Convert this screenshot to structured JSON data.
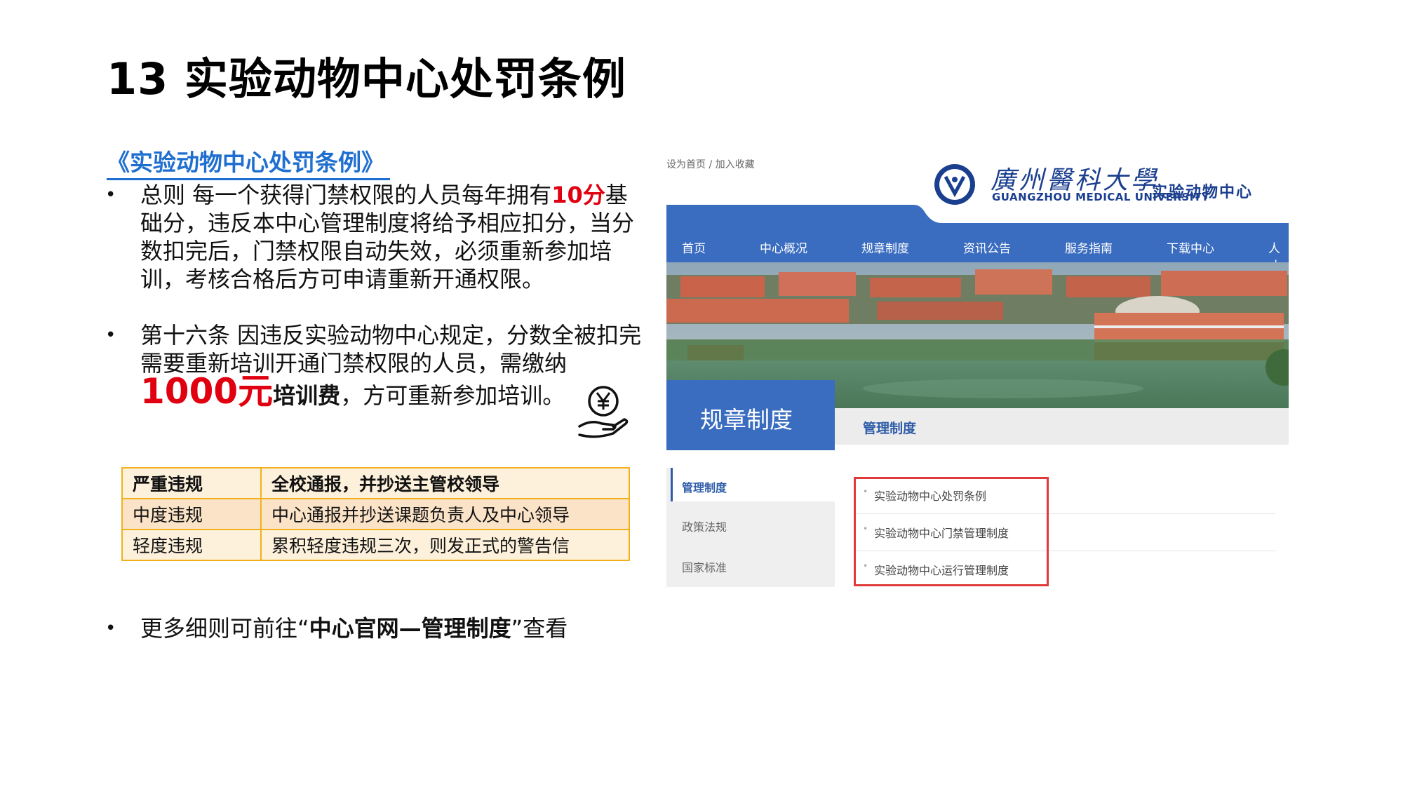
{
  "slide": {
    "title": "13 实验动物中心处罚条例",
    "doc_link": "《实验动物中心处罚条例》"
  },
  "bullets": {
    "b1_pre": "总则 每一个获得门禁权限的人员每年拥有",
    "b1_highlight": "10分",
    "b1_post": "基础分，违反本中心管理制度将给予相应扣分，当分数扣完后，门禁权限自动失效，必须重新参加培训，考核合格后方可申请重新开通权限。",
    "b2_pre": "第十六条 因违反实验动物中心规定，分数全被扣完需要重新培训开通门禁权限的人员，需缴纳",
    "b2_amount": "1000元",
    "b2_bold": "培训费",
    "b2_post": "，方可重新参加培训。",
    "b3_pre": "更多细则可前往“",
    "b3_bold": "中心官网—管理制度",
    "b3_post": "”查看",
    "dot": "•"
  },
  "table": {
    "rows": [
      [
        "严重违规",
        "全校通报，并抄送主管校领导"
      ],
      [
        "中度违规",
        "中心通报并抄送课题负责人及中心领导"
      ],
      [
        "轻度违规",
        "累积轻度违规三次，则发正式的警告信"
      ]
    ]
  },
  "website": {
    "topbar": "设为首页 / 加入收藏",
    "logo_cn": "廣州醫科大學",
    "logo_en": "GUANGZHOU MEDICAL UNIVERSITY",
    "logo_center": "实验动物中心",
    "nav": [
      "首页",
      "中心概况",
      "规章制度",
      "资讯公告",
      "服务指南",
      "下载中心",
      "人才"
    ],
    "sidebar_title": "规章制度",
    "section_title": "管理制度",
    "side_menu": [
      "管理制度",
      "政策法规",
      "国家标准"
    ],
    "links": [
      "实验动物中心处罚条例",
      "实验动物中心门禁管理制度",
      "实验动物中心运行管理制度"
    ],
    "colors": {
      "nav_blue": "#3a6cc0",
      "brand_blue": "#1b3f8f",
      "highlight_red": "#e03a3a"
    }
  },
  "colors": {
    "accent_red": "#e0000f",
    "link_blue": "#1f6fd0",
    "table_border": "#f2b01e"
  }
}
